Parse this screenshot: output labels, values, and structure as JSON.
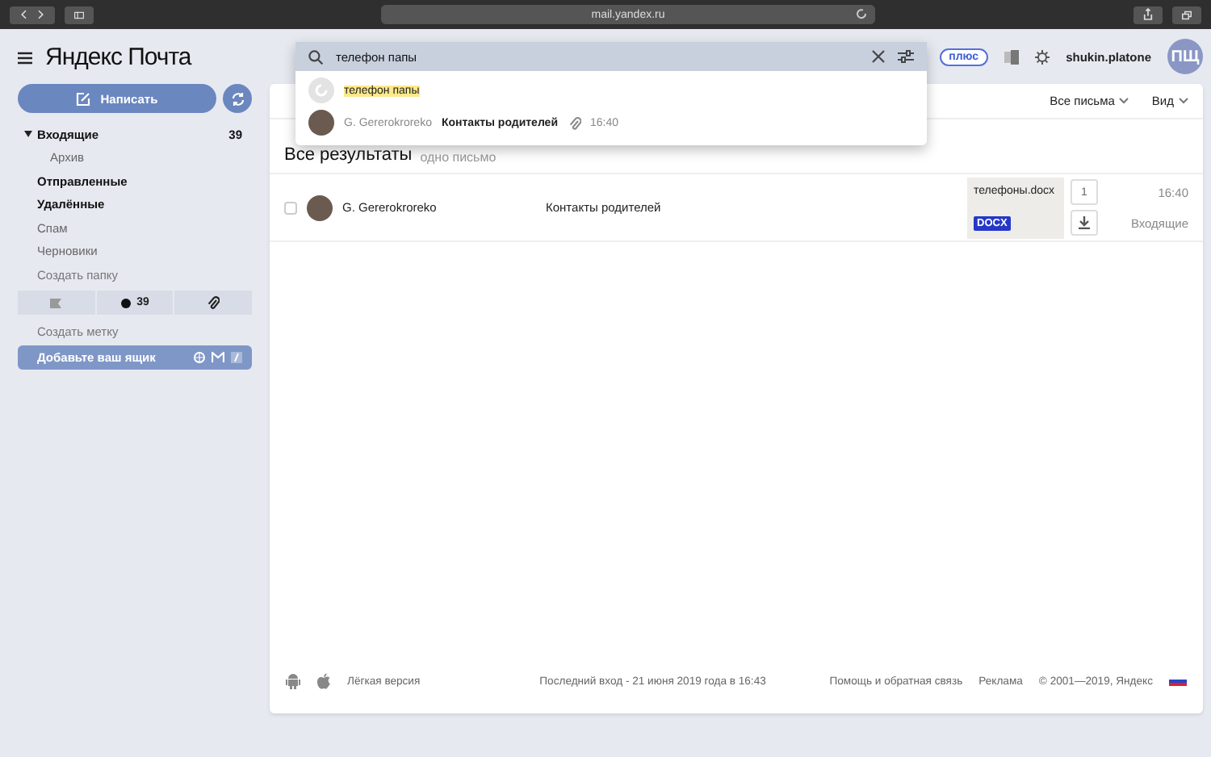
{
  "browser": {
    "url": "mail.yandex.ru"
  },
  "header": {
    "logo": "Яндекс Почта",
    "plus_badge": "плюс",
    "username": "shukin.platone",
    "avatar_initials": "ПЩ"
  },
  "search": {
    "value": "телефон папы",
    "suggestions": [
      {
        "kind": "query",
        "text": "телефон папы"
      },
      {
        "kind": "message",
        "sender": "G. Gererokroreko",
        "subject": "Контакты родителей",
        "time": "16:40"
      }
    ]
  },
  "sidebar": {
    "compose_button": "Написать",
    "folders": [
      {
        "label": "Входящие",
        "count": "39",
        "unread": true,
        "expanded": true,
        "children": [
          {
            "label": "Архив",
            "unread": false
          }
        ]
      },
      {
        "label": "Отправленные",
        "unread": true
      },
      {
        "label": "Удалённые",
        "unread": true
      },
      {
        "label": "Спам",
        "unread": false
      },
      {
        "label": "Черновики",
        "unread": false
      }
    ],
    "create_folder": "Создать папку",
    "filters": [
      {
        "kind": "flag"
      },
      {
        "kind": "unread",
        "text": "39"
      },
      {
        "kind": "attachment"
      }
    ],
    "create_label": "Создать метку",
    "add_mailbox": "Добавьте ваш ящик"
  },
  "toolbar": {
    "filter": "Все письма",
    "view": "Вид"
  },
  "results": {
    "title": "Все результаты",
    "subtitle": "одно письмо"
  },
  "messages": [
    {
      "sender": "G. Gererokroreko",
      "subject": "Контакты родителей",
      "selected": false,
      "attachment": {
        "name": "телефоны.docx",
        "type": "DOCX"
      },
      "attachment_count": "1",
      "time": "16:40",
      "folder": "Входящие"
    }
  ],
  "footer": {
    "light_version": "Лёгкая версия",
    "last_login": "Последний вход - 21 июня 2019 года в 16:43",
    "help": "Помощь и обратная связь",
    "ads": "Реклама",
    "copyright": "© 2001—2019, Яндекс"
  }
}
